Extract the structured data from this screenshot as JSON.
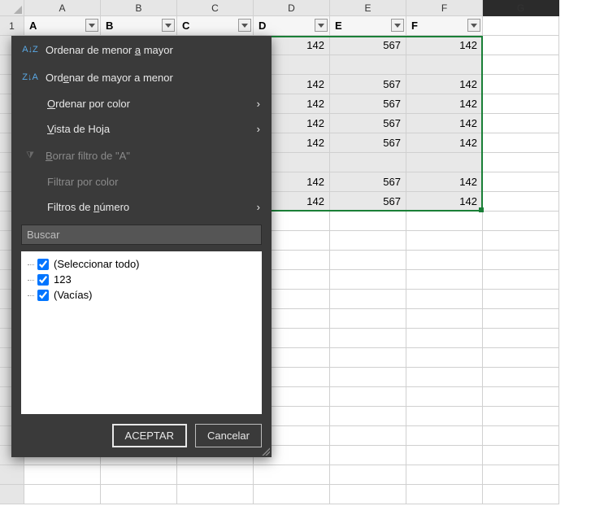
{
  "columns": [
    "A",
    "B",
    "C",
    "D",
    "E",
    "F",
    "G"
  ],
  "row_labels": [
    "1"
  ],
  "filter_headers": [
    "A",
    "B",
    "C",
    "D",
    "E",
    "F"
  ],
  "data_rows": [
    {
      "D": "142",
      "E": "567",
      "F": "142"
    },
    {
      "D": "",
      "E": "",
      "F": ""
    },
    {
      "D": "142",
      "E": "567",
      "F": "142"
    },
    {
      "D": "142",
      "E": "567",
      "F": "142"
    },
    {
      "D": "142",
      "E": "567",
      "F": "142"
    },
    {
      "D": "142",
      "E": "567",
      "F": "142"
    },
    {
      "D": "",
      "E": "",
      "F": ""
    },
    {
      "D": "142",
      "E": "567",
      "F": "142"
    },
    {
      "D": "142",
      "E": "567",
      "F": "142"
    }
  ],
  "menu": {
    "sort_asc": "Ordenar de menor a mayor",
    "sort_desc": "Ordenar de mayor a menor",
    "sort_color": "Ordenar por color",
    "sheet_view": "Vista de Hoja",
    "clear_filter": "Borrar filtro de \"A\"",
    "filter_color": "Filtrar por color",
    "number_filters": "Filtros de número",
    "search_placeholder": "Buscar",
    "checks": {
      "select_all": "(Seleccionar todo)",
      "v123": "123",
      "blanks": "(Vacías)"
    },
    "ok": "ACEPTAR",
    "cancel": "Cancelar"
  },
  "icons": {
    "sort_asc": "A↓Z",
    "sort_desc": "Z↓A",
    "funnel": "⧩"
  },
  "colors": {
    "selection_border": "#1a7f37",
    "panel_bg": "#3a3a3a"
  }
}
